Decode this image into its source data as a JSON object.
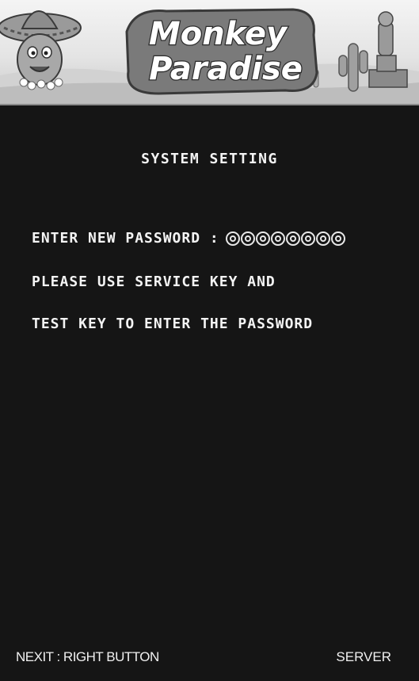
{
  "banner": {
    "logo_line1": "Monkey",
    "logo_line2": "Paradise"
  },
  "screen": {
    "title": "SYSTEM SETTING",
    "password_label": "ENTER NEW PASSWORD :",
    "password_slots": 8,
    "instruction_line1": "PLEASE USE SERVICE KEY AND",
    "instruction_line2": "TEST KEY TO ENTER THE PASSWORD"
  },
  "footer": {
    "left": "NEXIT : RIGHT BUTTON",
    "right": "SERVER"
  },
  "colors": {
    "background": "#151515",
    "text": "#f4f4f4"
  }
}
